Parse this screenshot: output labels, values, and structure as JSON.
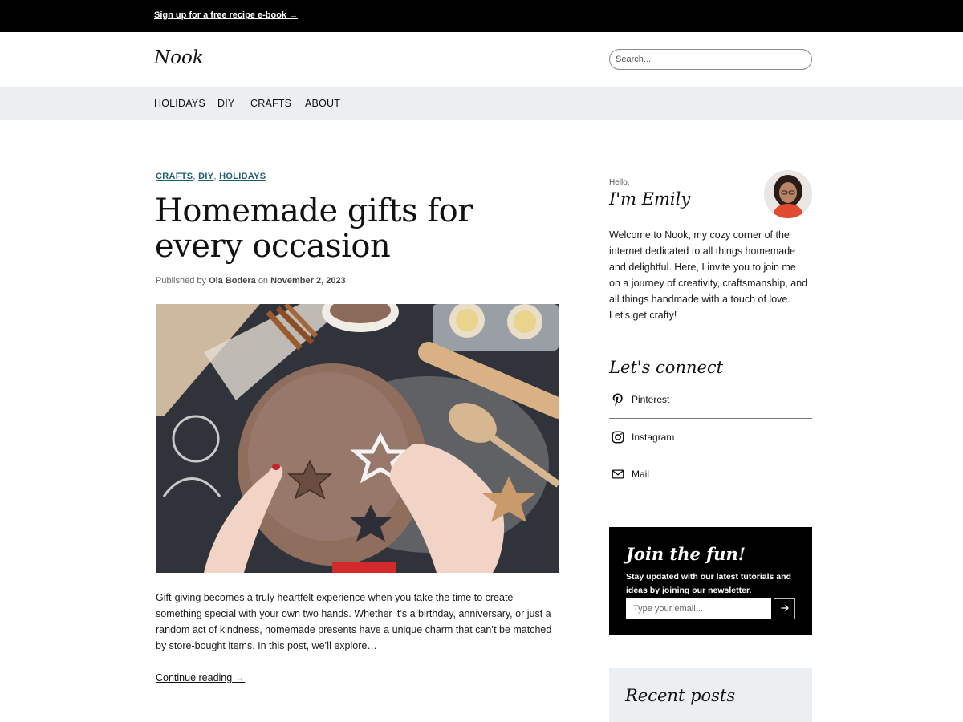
{
  "announcement": {
    "text": "Sign up for a free recipe e-book →"
  },
  "header": {
    "logo": "Nook",
    "search_placeholder": "Search..."
  },
  "nav": {
    "items": [
      "HOLIDAYS",
      "DIY",
      "CRAFTS",
      "ABOUT"
    ]
  },
  "post": {
    "categories": [
      "CRAFTS",
      "DIY",
      "HOLIDAYS"
    ],
    "title": "Homemade gifts for every occasion",
    "byline_prefix": "Published by",
    "author": "Ola Bodera",
    "byline_on": "on",
    "date": "November 2, 2023",
    "excerpt": "Gift-giving becomes a truly heartfelt experience when you take the time to create something special with your own two hands. Whether it’s a birthday, anniversary, or just a random act of kindness, homemade presents have a unique charm that can’t be matched by store-bought items. In this post, we’ll explore…",
    "continue_label": "Continue reading →"
  },
  "sidebar": {
    "hello": "Hello,",
    "name_line": "I'm Emily",
    "bio": "Welcome to Nook, my cozy corner of the internet dedicated to all things homemade and delightful. Here, I invite you to join me on a journey of creativity, craftsmanship, and all things handmade with a touch of love. Let's get crafty!",
    "connect_title": "Let's connect",
    "social": [
      {
        "label": "Pinterest",
        "icon": "pinterest-icon"
      },
      {
        "label": "Instagram",
        "icon": "instagram-icon"
      },
      {
        "label": "Mail",
        "icon": "mail-icon"
      }
    ],
    "newsletter": {
      "title": "Join the fun!",
      "text": "Stay updated with our latest tutorials and ideas by joining our newsletter.",
      "placeholder": "Type your email...",
      "submit_icon": "arrow-right-icon"
    },
    "recent_title": "Recent posts"
  },
  "colors": {
    "topbar": "#000000",
    "nav_bg": "#ebeff2",
    "category_link": "#1f5f6b",
    "newsletter_bg": "#000000",
    "recent_bg": "#ebeff2"
  }
}
